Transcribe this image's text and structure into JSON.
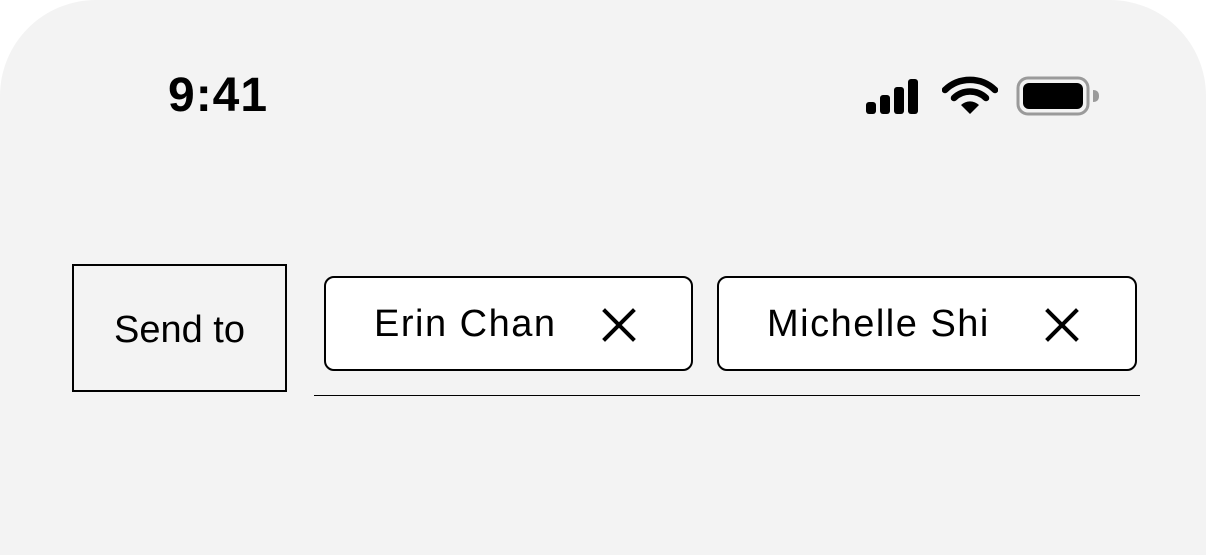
{
  "status_bar": {
    "time": "9:41",
    "icons": [
      "cellular-signal-icon",
      "wifi-icon",
      "battery-icon"
    ]
  },
  "compose": {
    "send_to_label": "Send to",
    "recipients": [
      {
        "name": "Erin Chan",
        "remove_icon": "close-icon"
      },
      {
        "name": "Michelle Shi",
        "remove_icon": "close-icon"
      }
    ]
  },
  "colors": {
    "background": "#f3f3f3",
    "chip_background": "#ffffff",
    "text": "#000000"
  }
}
